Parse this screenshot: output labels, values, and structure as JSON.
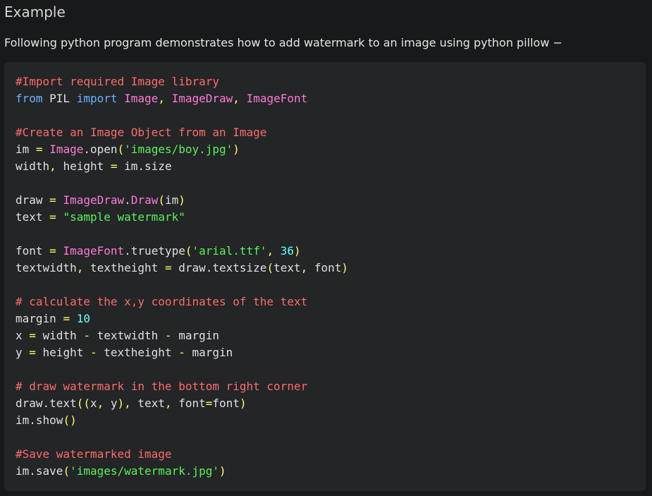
{
  "heading": "Example",
  "intro": "Following python program demonstrates how to add watermark to an image using python pillow −",
  "colors": {
    "background": "#18191a",
    "code_background": "#232527",
    "comment": "#ff6b6b",
    "keyword": "#6cb2ff",
    "class": "#ff7bd5",
    "operator": "#ffff66",
    "string": "#5cf25c",
    "number": "#66ffff",
    "plain": "#e0e0e0"
  },
  "code": {
    "language": "python",
    "lines": [
      [
        [
          "comment",
          "#Import required Image library"
        ]
      ],
      [
        [
          "keyword",
          "from"
        ],
        [
          "plain",
          " PIL "
        ],
        [
          "keyword",
          "import"
        ],
        [
          "plain",
          " "
        ],
        [
          "class",
          "Image"
        ],
        [
          "op",
          ","
        ],
        [
          "plain",
          " "
        ],
        [
          "class",
          "ImageDraw"
        ],
        [
          "op",
          ","
        ],
        [
          "plain",
          " "
        ],
        [
          "class",
          "ImageFont"
        ]
      ],
      [],
      [
        [
          "comment",
          "#Create an Image Object from an Image"
        ]
      ],
      [
        [
          "plain",
          "im "
        ],
        [
          "op",
          "="
        ],
        [
          "plain",
          " "
        ],
        [
          "class",
          "Image"
        ],
        [
          "plain",
          ".open"
        ],
        [
          "paren",
          "("
        ],
        [
          "string",
          "'images/boy.jpg'"
        ],
        [
          "paren",
          ")"
        ]
      ],
      [
        [
          "plain",
          "width"
        ],
        [
          "op",
          ","
        ],
        [
          "plain",
          " height "
        ],
        [
          "op",
          "="
        ],
        [
          "plain",
          " im.size"
        ]
      ],
      [],
      [
        [
          "plain",
          "draw "
        ],
        [
          "op",
          "="
        ],
        [
          "plain",
          " "
        ],
        [
          "class",
          "ImageDraw"
        ],
        [
          "plain",
          "."
        ],
        [
          "method",
          "Draw"
        ],
        [
          "paren",
          "("
        ],
        [
          "plain",
          "im"
        ],
        [
          "paren",
          ")"
        ]
      ],
      [
        [
          "plain",
          "text "
        ],
        [
          "op",
          "="
        ],
        [
          "plain",
          " "
        ],
        [
          "string",
          "\"sample watermark\""
        ]
      ],
      [],
      [
        [
          "plain",
          "font "
        ],
        [
          "op",
          "="
        ],
        [
          "plain",
          " "
        ],
        [
          "class",
          "ImageFont"
        ],
        [
          "plain",
          ".truetype"
        ],
        [
          "paren",
          "("
        ],
        [
          "string",
          "'arial.ttf'"
        ],
        [
          "op",
          ","
        ],
        [
          "plain",
          " "
        ],
        [
          "number",
          "36"
        ],
        [
          "paren",
          ")"
        ]
      ],
      [
        [
          "plain",
          "textwidth"
        ],
        [
          "op",
          ","
        ],
        [
          "plain",
          " textheight "
        ],
        [
          "op",
          "="
        ],
        [
          "plain",
          " draw.textsize"
        ],
        [
          "paren",
          "("
        ],
        [
          "plain",
          "text"
        ],
        [
          "op",
          ","
        ],
        [
          "plain",
          " font"
        ],
        [
          "paren",
          ")"
        ]
      ],
      [],
      [
        [
          "comment",
          "# calculate the x,y coordinates of the text"
        ]
      ],
      [
        [
          "plain",
          "margin "
        ],
        [
          "op",
          "="
        ],
        [
          "plain",
          " "
        ],
        [
          "number",
          "10"
        ]
      ],
      [
        [
          "plain",
          "x "
        ],
        [
          "op",
          "="
        ],
        [
          "plain",
          " width "
        ],
        [
          "op",
          "-"
        ],
        [
          "plain",
          " textwidth "
        ],
        [
          "op",
          "-"
        ],
        [
          "plain",
          " margin"
        ]
      ],
      [
        [
          "plain",
          "y "
        ],
        [
          "op",
          "="
        ],
        [
          "plain",
          " height "
        ],
        [
          "op",
          "-"
        ],
        [
          "plain",
          " textheight "
        ],
        [
          "op",
          "-"
        ],
        [
          "plain",
          " margin"
        ]
      ],
      [],
      [
        [
          "comment",
          "# draw watermark in the bottom right corner"
        ]
      ],
      [
        [
          "plain",
          "draw.text"
        ],
        [
          "paren",
          "(("
        ],
        [
          "plain",
          "x"
        ],
        [
          "op",
          ","
        ],
        [
          "plain",
          " y"
        ],
        [
          "paren",
          ")"
        ],
        [
          "op",
          ","
        ],
        [
          "plain",
          " text"
        ],
        [
          "op",
          ","
        ],
        [
          "plain",
          " font"
        ],
        [
          "op",
          "="
        ],
        [
          "plain",
          "font"
        ],
        [
          "paren",
          ")"
        ]
      ],
      [
        [
          "plain",
          "im.show"
        ],
        [
          "paren",
          "()"
        ]
      ],
      [],
      [
        [
          "comment",
          "#Save watermarked image"
        ]
      ],
      [
        [
          "plain",
          "im.save"
        ],
        [
          "paren",
          "("
        ],
        [
          "string",
          "'images/watermark.jpg'"
        ],
        [
          "paren",
          ")"
        ]
      ]
    ]
  }
}
